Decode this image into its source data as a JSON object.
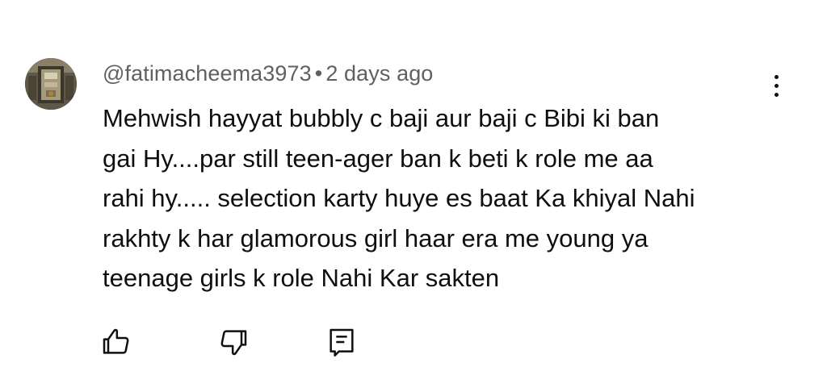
{
  "comment": {
    "author": "@fatimacheema3973",
    "separator": "•",
    "timestamp": "2 days ago",
    "text_lines": [
      "Mehwish hayyat bubbly c baji aur baji c Bibi ki ban",
      "gai Hy....par still teen-ager ban k beti k role me aa",
      "rahi hy..... selection karty huye es baat Ka khiyal Nahi",
      "rakhty k har glamorous girl haar era me young ya",
      "teenage girls k role Nahi Kar sakten"
    ]
  },
  "icons": {
    "avatar": "avatar-image",
    "menu": "more-vert-icon",
    "like": "thumb-up-icon",
    "dislike": "thumb-down-icon",
    "reply": "comment-icon"
  },
  "colors": {
    "text": "#0f0f0f",
    "secondary": "#606060",
    "background": "#ffffff"
  }
}
